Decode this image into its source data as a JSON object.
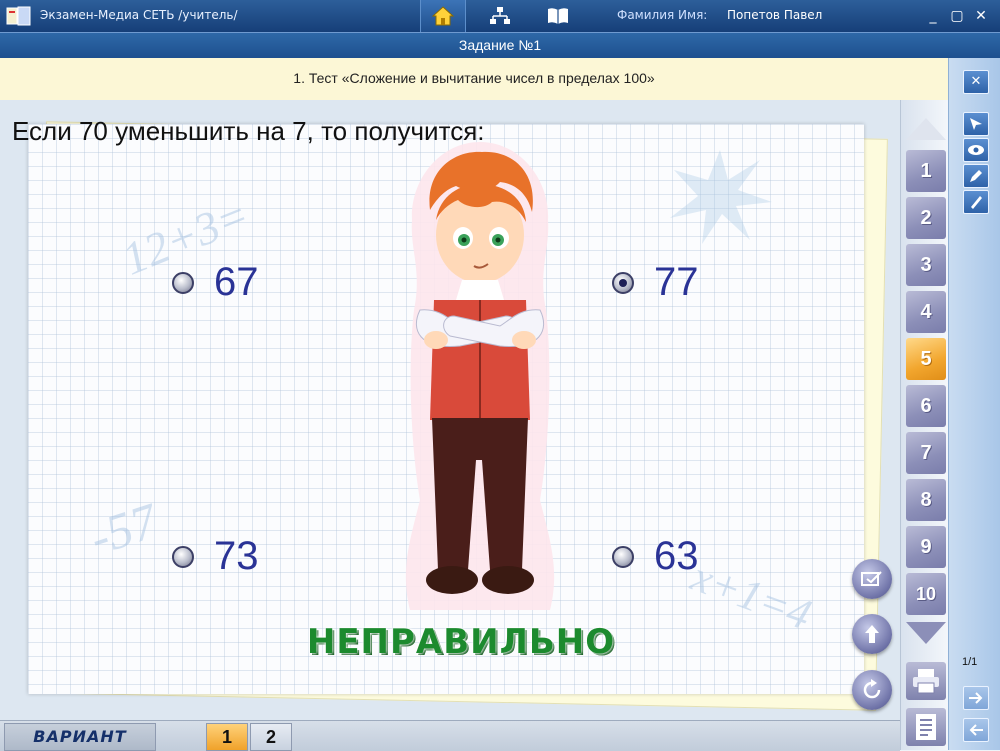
{
  "titlebar": {
    "app_title": "Экзамен-Медиа СЕТЬ /учитель/",
    "user_label": "Фамилия Имя:",
    "user_name": "Попетов Павел",
    "minimize": "_",
    "maximize": "▢",
    "close": "✕"
  },
  "task": {
    "title": "Задание №1"
  },
  "subject": {
    "text": "1. Тест «Сложение и вычитание чисел в пределах 100»"
  },
  "question": {
    "text": "Если 70 уменьшить на 7, то получится:",
    "options": [
      {
        "label": "67",
        "selected": false
      },
      {
        "label": "77",
        "selected": true
      },
      {
        "label": "73",
        "selected": false
      },
      {
        "label": "63",
        "selected": false
      }
    ]
  },
  "result": {
    "verdict": "НЕПРАВИЛЬНО"
  },
  "question_nav": {
    "items": [
      "1",
      "2",
      "3",
      "4",
      "5",
      "6",
      "7",
      "8",
      "9",
      "10"
    ],
    "active": "5"
  },
  "pager": {
    "text": "1/1"
  },
  "bottom": {
    "variant_label": "ВАРИАНТ",
    "variants": [
      "1",
      "2"
    ],
    "active_variant": "1"
  },
  "colors": {
    "title_bar": "#1f4e8c",
    "active_tab": "#f2a62e",
    "option_text": "#2a3396",
    "verdict": "#1c8a2e"
  }
}
